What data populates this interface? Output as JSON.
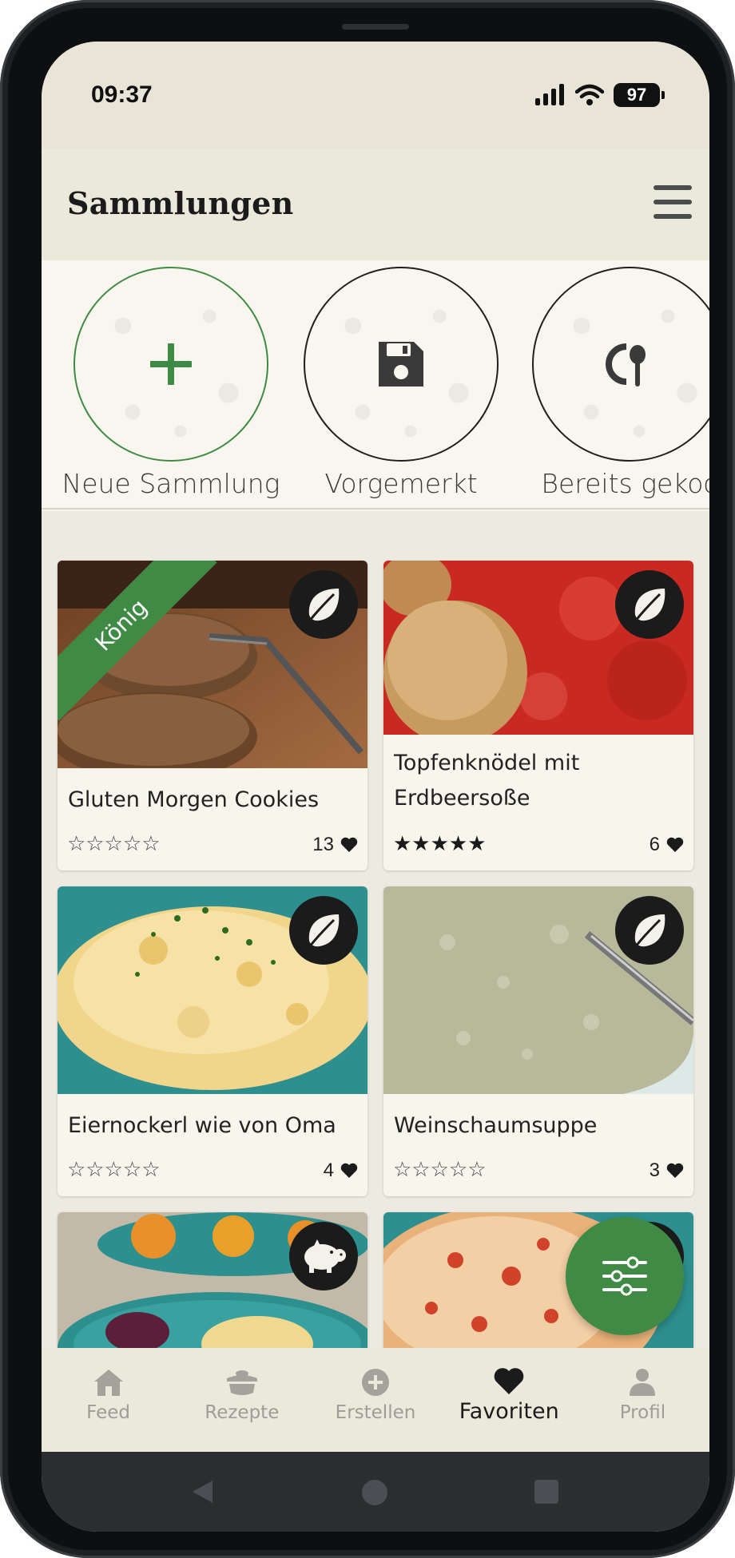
{
  "status": {
    "time": "09:37",
    "battery": "97"
  },
  "header": {
    "title": "Sammlungen"
  },
  "collections": [
    {
      "label": "Neue Sammlung",
      "icon": "plus-icon"
    },
    {
      "label": "Vorgemerkt",
      "icon": "floppy-disk-icon"
    },
    {
      "label": "Bereits gekoc",
      "icon": "cooked-spoon-icon"
    }
  ],
  "recipes": [
    {
      "title": "Gluten Morgen Cookies",
      "stars": "☆☆☆☆☆",
      "likes": "13",
      "ribbon": "König",
      "diet": "leaf-icon"
    },
    {
      "title": "Topfenknödel mit Erdbeersoße",
      "stars": "★★★★★",
      "likes": "6",
      "diet": "leaf-icon"
    },
    {
      "title": "Eiernockerl wie von Oma",
      "stars": "☆☆☆☆☆",
      "likes": "4",
      "diet": "leaf-icon"
    },
    {
      "title": "Weinschaumsuppe",
      "stars": "☆☆☆☆☆",
      "likes": "3",
      "diet": "leaf-icon"
    },
    {
      "title": "",
      "diet": "pig-icon"
    },
    {
      "title": "",
      "diet": "leaf-icon"
    }
  ],
  "nav": [
    {
      "label": "Feed",
      "icon": "home-icon"
    },
    {
      "label": "Rezepte",
      "icon": "pot-icon"
    },
    {
      "label": "Erstellen",
      "icon": "add-circle-icon"
    },
    {
      "label": "Favoriten",
      "icon": "heart-icon",
      "active": true
    },
    {
      "label": "Profil",
      "icon": "person-icon"
    }
  ],
  "colors": {
    "accent": "#3f8a44",
    "background": "#f5f3ec",
    "header": "#ebe8dc",
    "badge": "#1b1b1b"
  }
}
